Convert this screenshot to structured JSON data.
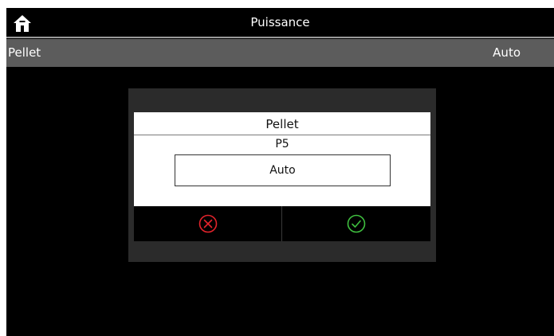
{
  "header": {
    "title": "Puissance",
    "home_icon": "home-icon"
  },
  "subbar": {
    "left_label": "Pellet",
    "right_value": "Auto"
  },
  "dialog": {
    "title": "Pellet",
    "code": "P5",
    "value": "Auto",
    "cancel_icon": "cancel-icon",
    "confirm_icon": "confirm-icon",
    "colors": {
      "cancel": "#e2232b",
      "confirm": "#3fbf3f"
    }
  }
}
